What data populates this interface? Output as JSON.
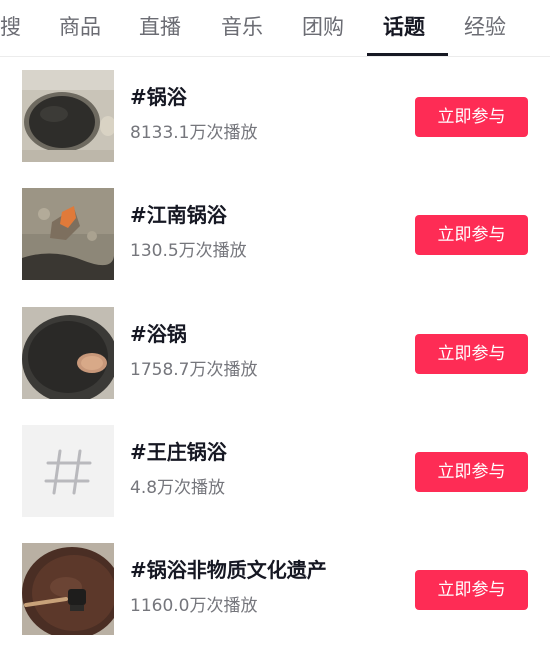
{
  "tabs": [
    {
      "label": "搜"
    },
    {
      "label": "商品"
    },
    {
      "label": "直播"
    },
    {
      "label": "音乐"
    },
    {
      "label": "团购"
    },
    {
      "label": "话题",
      "active": true
    },
    {
      "label": "经验"
    }
  ],
  "topics": [
    {
      "title": "#锅浴",
      "views": "8133.1万次播放",
      "button": "立即参与",
      "thumb": "pot-photo"
    },
    {
      "title": "#江南锅浴",
      "views": "130.5万次播放",
      "button": "立即参与",
      "thumb": "wall-photo"
    },
    {
      "title": "#浴锅",
      "views": "1758.7万次播放",
      "button": "立即参与",
      "thumb": "pot-photo"
    },
    {
      "title": "#王庄锅浴",
      "views": "4.8万次播放",
      "button": "立即参与",
      "thumb": "hashtag-icon"
    },
    {
      "title": "#锅浴非物质文化遗产",
      "views": "1160.0万次播放",
      "button": "立即参与",
      "thumb": "pot-brush-photo"
    }
  ],
  "colors": {
    "accent": "#fe2c55",
    "text": "#161823",
    "secondary": "#75767c"
  }
}
